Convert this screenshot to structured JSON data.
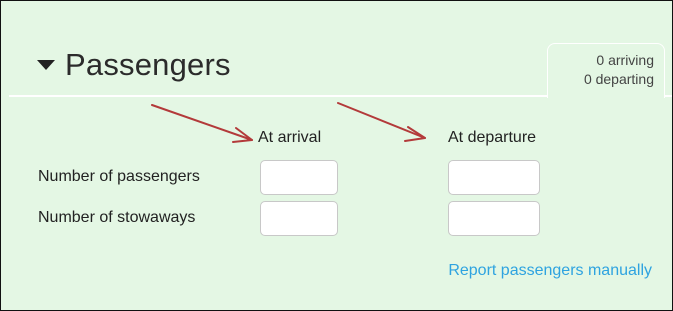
{
  "section": {
    "title": "Passengers",
    "toggle_icon": "caret-down-icon"
  },
  "summary": {
    "arriving": "0 arriving",
    "departing": "0 departing"
  },
  "columns": {
    "arrival": "At arrival",
    "departure": "At departure"
  },
  "rows": {
    "passengers_label": "Number of passengers",
    "stowaways_label": "Number of stowaways"
  },
  "inputs": {
    "arrival_passengers": "",
    "arrival_stowaways": "",
    "departure_passengers": "",
    "departure_stowaways": ""
  },
  "link": {
    "report_manually": "Report passengers manually"
  },
  "colors": {
    "panel_background": "#e4f7e4",
    "link": "#2ea3e0",
    "annotation_arrow": "#b33a3a"
  }
}
